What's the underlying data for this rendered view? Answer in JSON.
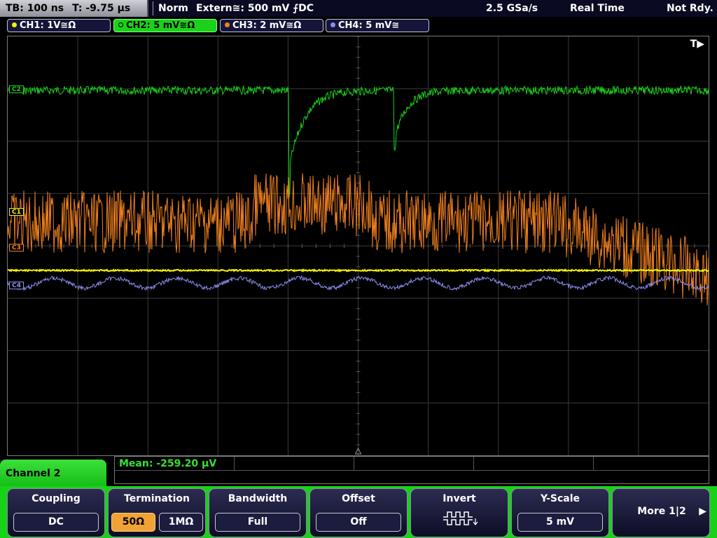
{
  "status": {
    "timebase": "TB: 100 ns",
    "trigger_time": "T: -9.75 µs",
    "mode": "Norm",
    "trigger_source": "Extern≅: 500 mV ⨍DC",
    "sample_rate": "2.5 GSa/s",
    "acq_mode": "Real Time",
    "state": "Not Rdy."
  },
  "channels": [
    {
      "label": "CH1: 1V≅Ω",
      "color": "#f2f200"
    },
    {
      "label": "CH2: 5 mV≅Ω",
      "color": "#19d219",
      "active": true
    },
    {
      "label": "CH3: 2 mV≅Ω",
      "color": "#f0801e"
    },
    {
      "label": "CH4: 5 mV≅",
      "color": "#8c8cf0"
    }
  ],
  "plot": {
    "trigger_indicator": "T▶",
    "markers": {
      "c2": "C2",
      "c1": "C1",
      "c3": "C3",
      "c4": "C4"
    }
  },
  "measurement": {
    "text": "Mean: -259.20 µV"
  },
  "menu": {
    "title": "Channel 2",
    "keys": {
      "coupling": {
        "label": "Coupling",
        "value": "DC"
      },
      "termination": {
        "label": "Termination",
        "options": [
          "50Ω",
          "1MΩ"
        ],
        "selected": "50Ω"
      },
      "bandwidth": {
        "label": "Bandwidth",
        "value": "Full"
      },
      "offset": {
        "label": "Offset",
        "value": "Off"
      },
      "invert": {
        "label": "Invert",
        "icon": "invert-waveform-icon"
      },
      "yscale": {
        "label": "Y-Scale",
        "value": "5 mV"
      },
      "more": {
        "label": "More 1|2",
        "icon": "arrow-right-icon"
      }
    }
  },
  "colors": {
    "ch1": "#f2f200",
    "ch2": "#19d219",
    "ch3": "#f0801e",
    "ch4": "#8c8cf0",
    "menu_accent": "#18d218",
    "selected_option": "#f0a236"
  }
}
